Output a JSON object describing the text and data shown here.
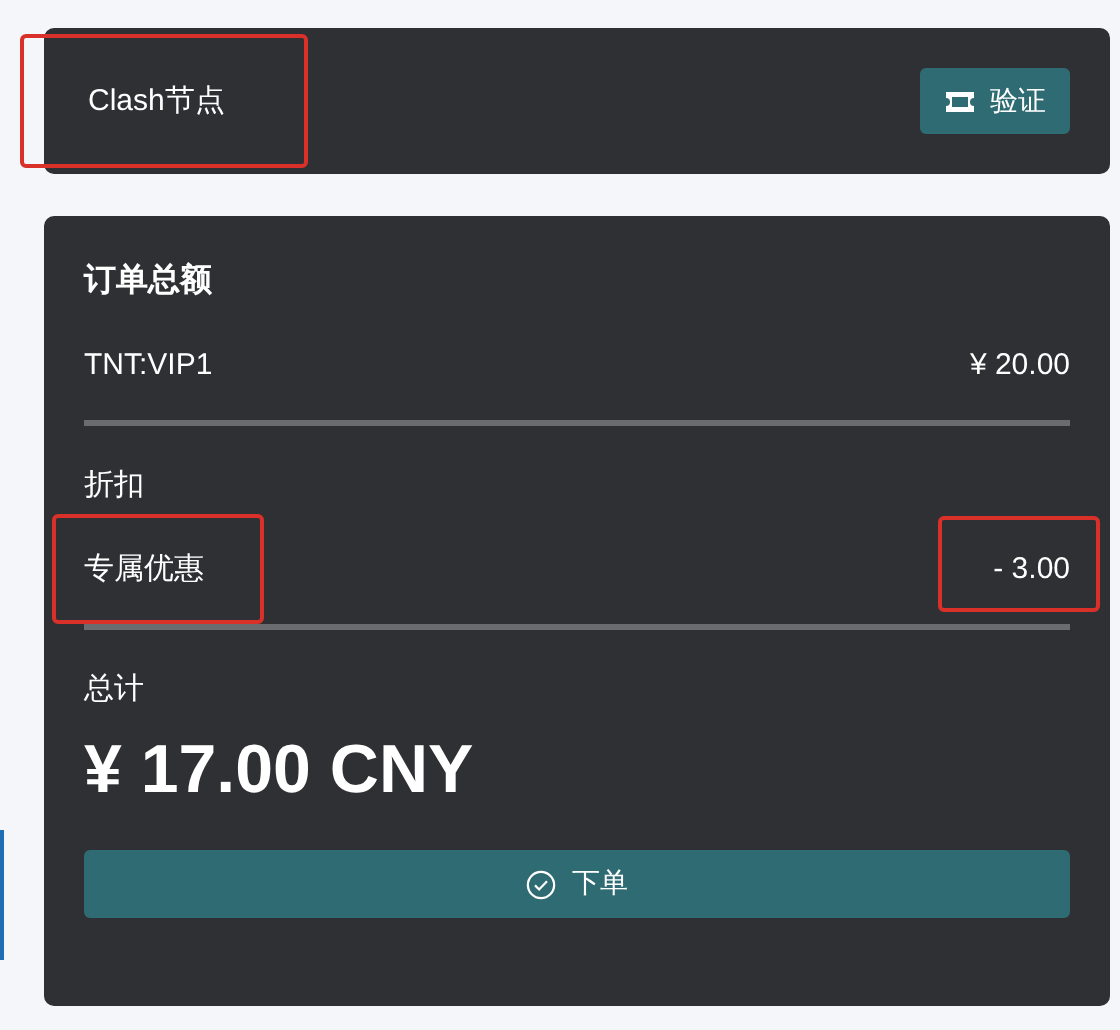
{
  "node_card": {
    "title": "Clash节点",
    "highlighted": true,
    "button": "验证"
  },
  "order": {
    "heading": "订单总额",
    "items": [
      {
        "label": "TNT:VIP1",
        "amount": "¥ 20.00"
      }
    ],
    "discount": {
      "heading": "折扣",
      "items": [
        {
          "label": "专属优惠",
          "amount": "- 3.00",
          "label_highlighted": true,
          "amount_highlighted": true
        }
      ]
    },
    "total": {
      "heading": "总计",
      "amount": "¥ 17.00 CNY"
    },
    "button": "下单"
  }
}
